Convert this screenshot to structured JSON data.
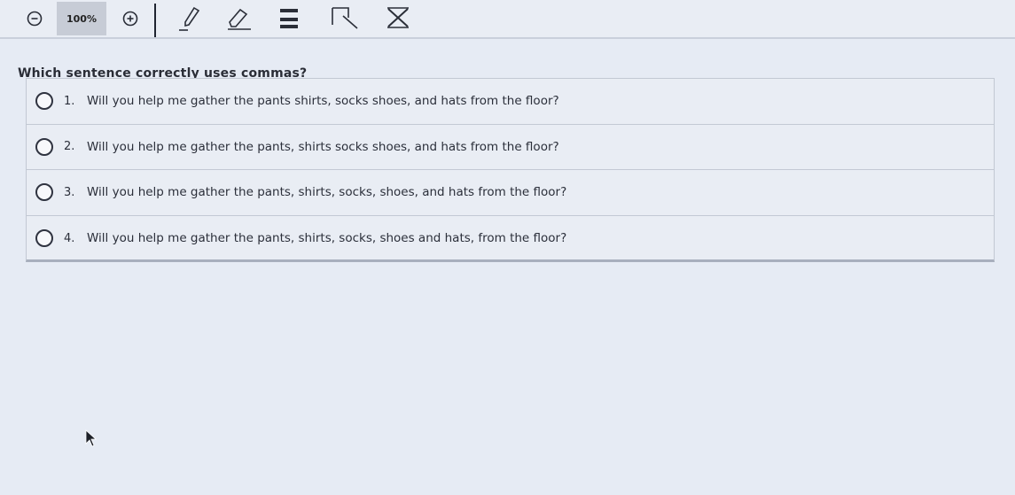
{
  "toolbar": {
    "zoom_level": "100%",
    "icons": [
      "zoom-out-icon",
      "zoom-in-icon",
      "pen-icon",
      "eraser-icon",
      "highlighter-icon",
      "reference-icon",
      "crossout-icon"
    ]
  },
  "question": {
    "text": "Which sentence correctly uses commas?"
  },
  "choices": [
    {
      "number": "1.",
      "text": "Will you help me gather the pants shirts, socks shoes, and hats from the floor?"
    },
    {
      "number": "2.",
      "text": "Will you help me gather the pants, shirts socks shoes, and hats from the floor?"
    },
    {
      "number": "3.",
      "text": "Will you help me gather the pants, shirts, socks, shoes, and hats from the floor?"
    },
    {
      "number": "4.",
      "text": "Will you help me gather the pants, shirts, socks, shoes and hats, from the floor?"
    }
  ],
  "colors": {
    "background": "#e6ebf4",
    "text": "#2b2f3a",
    "zoom_badge": "#c7ccd6"
  }
}
